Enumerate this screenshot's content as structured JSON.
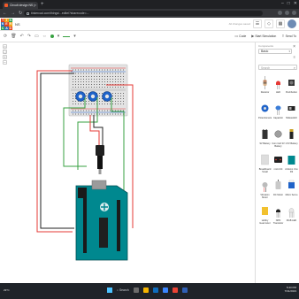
{
  "browser": {
    "tab_title": "Circuit design NS | Tinkercad",
    "url": "tinkercad.com/things/...editel?sharecode=...",
    "new_tab_symbol": "+",
    "controls": [
      "–",
      "□",
      "✕"
    ]
  },
  "tinkercad": {
    "logo_letters": [
      "T",
      "I",
      "N",
      "K",
      "E",
      "R",
      "C",
      "A",
      "D"
    ],
    "logo_colors": [
      "#e2421b",
      "#f2a51a",
      "#2a9d48",
      "#2f6fb4",
      "#e2421b",
      "#f2a51a",
      "#2a9d48",
      "#2f6fb4",
      "#e2421b"
    ],
    "doc_title": "NS",
    "save_status": "All changes saved"
  },
  "toolbar": {
    "code_label": "Code",
    "simulation_label": "Start Simulation",
    "export_label": "Send To",
    "wire_color": "#37a141"
  },
  "panel": {
    "components_label": "Components",
    "components_value": "Basic",
    "search_placeholder": "Search",
    "items": [
      {
        "label": "Resistor",
        "icon": "resistor-icon"
      },
      {
        "label": "LED",
        "icon": "led-icon"
      },
      {
        "label": "Pushbutton",
        "icon": "pushbutton-icon"
      },
      {
        "label": "Potentiometer",
        "icon": "potentiometer-icon"
      },
      {
        "label": "Capacitor",
        "icon": "capacitor-icon"
      },
      {
        "label": "Slideswitch",
        "icon": "slideswitch-icon"
      },
      {
        "label": "9V Battery",
        "icon": "battery-9v-icon"
      },
      {
        "label": "Coin Cell 3V Battery",
        "icon": "coin-cell-icon"
      },
      {
        "label": "1.5V Battery",
        "icon": "battery-aa-icon"
      },
      {
        "label": "Breadboard Small",
        "icon": "breadboard-icon"
      },
      {
        "label": "micro:bit",
        "icon": "microbit-icon"
      },
      {
        "label": "Arduino Uno R3",
        "icon": "arduino-icon"
      },
      {
        "label": "Vibration Motor",
        "icon": "vibration-motor-icon"
      },
      {
        "label": "DC Motor",
        "icon": "dc-motor-icon"
      },
      {
        "label": "Micro Servo",
        "icon": "servo-icon"
      },
      {
        "label": "Hobby Gearmotor",
        "icon": "gearmotor-icon"
      },
      {
        "label": "NPN Transistor",
        "icon": "transistor-icon"
      },
      {
        "label": "RGB LED",
        "icon": "rgb-led-icon"
      }
    ]
  },
  "taskbar": {
    "search_label": "Search",
    "time": "5:43 PM",
    "date": "7/31/2023",
    "weather": "29°C"
  }
}
